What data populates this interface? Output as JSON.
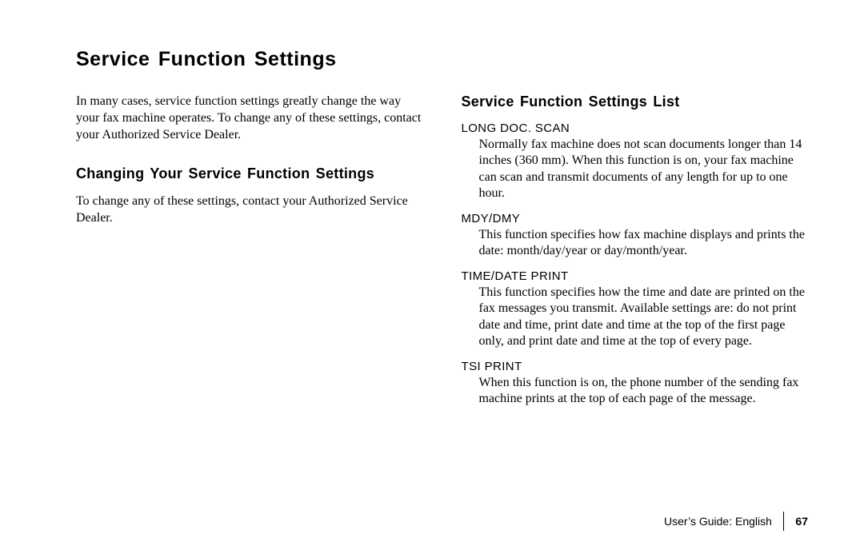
{
  "title": "Service Function Settings",
  "left": {
    "intro": "In many cases, service function settings greatly change the way your fax machine operates. To change any of these settings, contact your Authorized Service Dealer.",
    "subhead": "Changing Your Service Function Settings",
    "body": "To change any of these settings, contact your Authorized Service Dealer."
  },
  "right": {
    "subhead": "Service Function Settings List",
    "items": [
      {
        "label": "LONG DOC. SCAN",
        "desc": "Normally fax machine does not scan documents longer than 14 inches (360 mm). When this function is on, your fax machine can scan and transmit documents of any length for up to one hour."
      },
      {
        "label": "MDY/DMY",
        "desc": "This function specifies how fax machine displays and prints the date: month/day/year or day/month/year."
      },
      {
        "label": "TIME/DATE PRINT",
        "desc": "This function specifies how the time and date are printed on the fax messages you transmit. Available settings are: do not print date and time, print date and time at the top of the first page only, and print date and time at the top of every page."
      },
      {
        "label": "TSI PRINT",
        "desc": "When this function is on, the phone number of the sending fax machine prints at the top of each page of the message."
      }
    ]
  },
  "footer": {
    "label": "User’s Guide: English",
    "page": "67"
  }
}
